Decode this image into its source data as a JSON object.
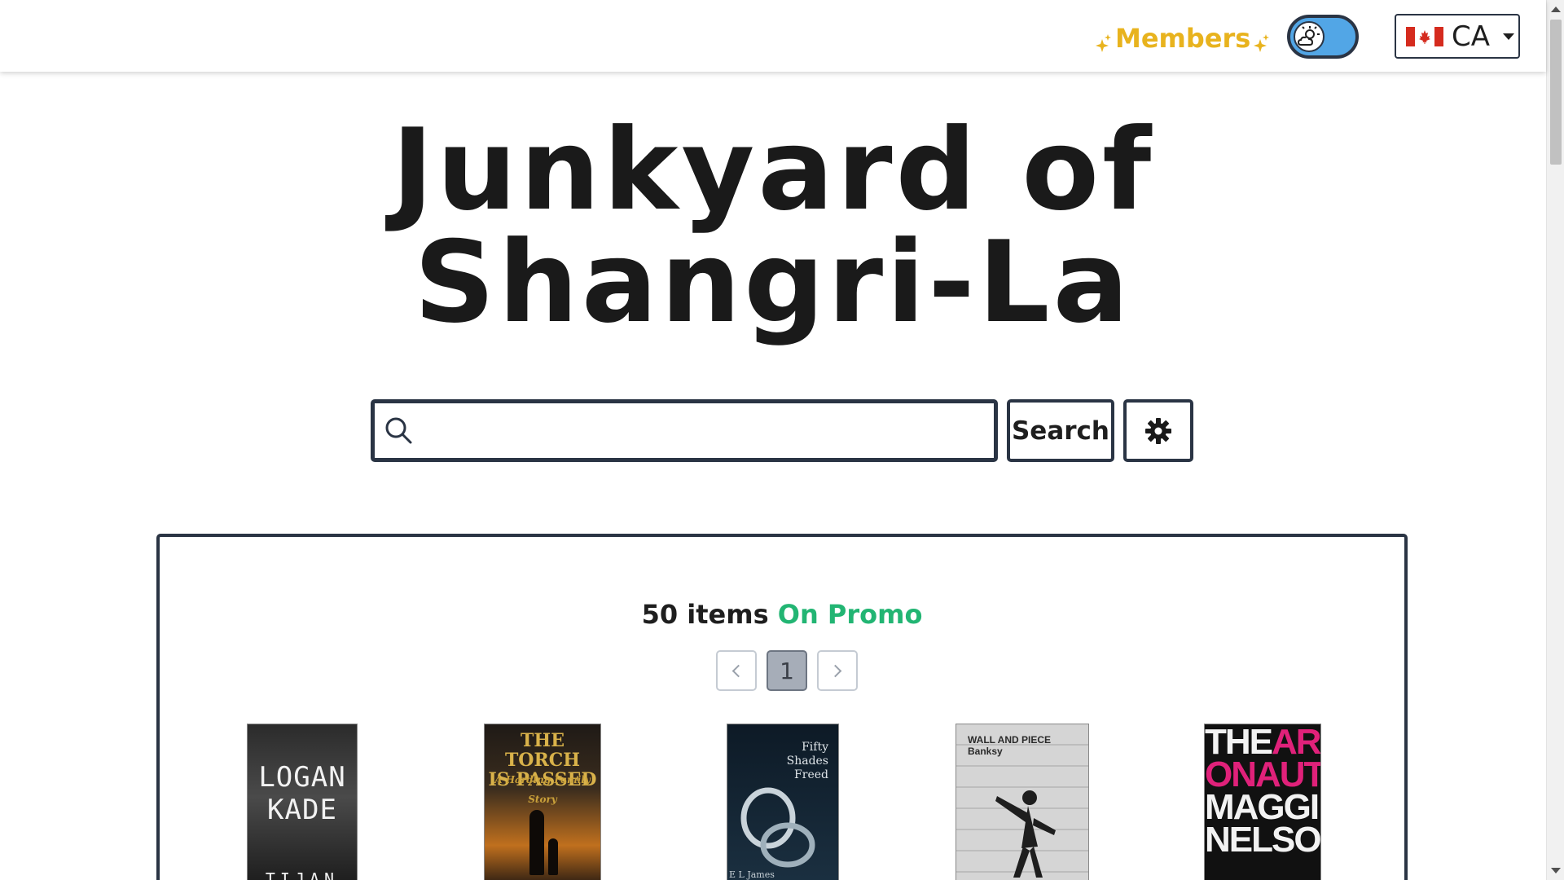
{
  "header": {
    "members_label": "Members",
    "theme_toggle": "day-night-toggle",
    "country": {
      "code": "CA",
      "flag": "canada-flag"
    }
  },
  "site": {
    "title_line1": "Junkyard of",
    "title_line2": "Shangri-La"
  },
  "search": {
    "placeholder": "",
    "value": "",
    "button_label": "Search"
  },
  "promo": {
    "count_text": "50 items",
    "accent_text": "On Promo",
    "accent_color": "#22b573",
    "current_page": "1"
  },
  "books": [
    {
      "title": "LOGAN KADE",
      "line1": "LOGAN",
      "line2": "KADE",
      "bottom": "TIJAN"
    },
    {
      "title": "THE TORCH IS PASSED",
      "line1": "THE TORCH",
      "line2": "IS PASSED",
      "sub": "A Harding Family Story"
    },
    {
      "title": "Fifty Shades Freed",
      "line1": "Fifty",
      "line2": "Shades",
      "line3": "Freed",
      "author": "E L James"
    },
    {
      "title": "WALL AND PIECE",
      "line1": "WALL AND PIECE",
      "line2": "Banksy"
    },
    {
      "title": "THE ARGONAUTS",
      "line1a": "THE",
      "line1b": "ARG",
      "line2": "ONAUTS",
      "line3": "MAGGIE",
      "line4": "NELSON"
    }
  ],
  "colors": {
    "members": "#e8b31e",
    "toggle_bg": "#52a6e6",
    "border": "#2a3444"
  }
}
